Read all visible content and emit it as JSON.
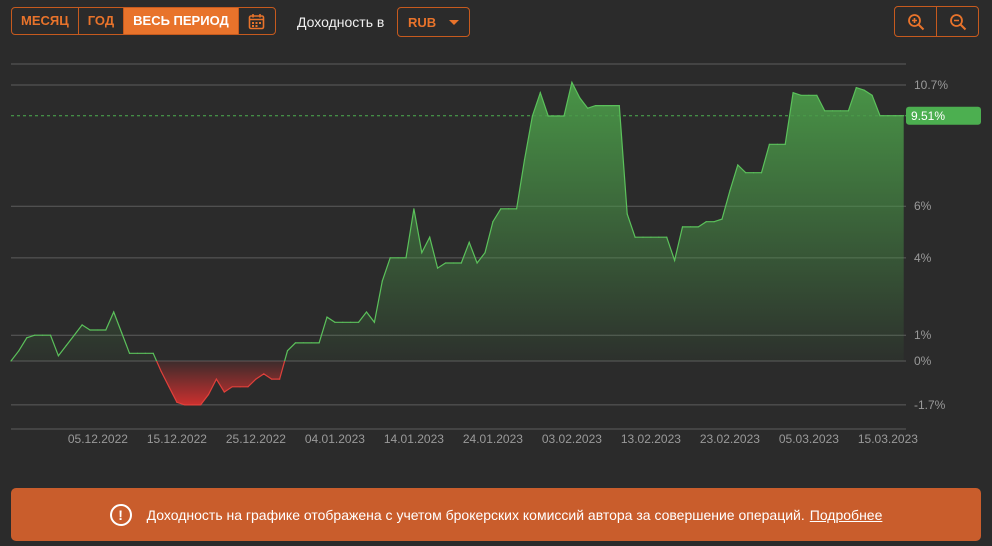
{
  "toolbar": {
    "periods": [
      "МЕСЯЦ",
      "ГОД",
      "ВЕСЬ ПЕРИОД"
    ],
    "active_period": "ВЕСЬ ПЕРИОД",
    "calendar_icon": "calendar-icon",
    "currency_label": "Доходность в",
    "currency_value": "RUB",
    "zoom_in_icon": "zoom-in-icon",
    "zoom_out_icon": "zoom-out-icon"
  },
  "colors": {
    "accent": "#e8732b",
    "positive": "#4caf50",
    "negative": "#d8302f",
    "banner": "#c95d2c"
  },
  "chart_data": {
    "type": "area",
    "y_unit": "%",
    "y_ticks": [
      {
        "value": 10.7,
        "label": "10.7%"
      },
      {
        "value": 6,
        "label": "6%"
      },
      {
        "value": 4,
        "label": "4%"
      },
      {
        "value": 1,
        "label": "1%"
      },
      {
        "value": 0,
        "label": "0%"
      },
      {
        "value": -1.7,
        "label": "-1.7%"
      }
    ],
    "x_ticks": [
      "05.12.2022",
      "15.12.2022",
      "25.12.2022",
      "04.01.2023",
      "14.01.2023",
      "24.01.2023",
      "03.02.2023",
      "13.02.2023",
      "23.02.2023",
      "05.03.2023",
      "15.03.2023"
    ],
    "current_value": 9.51,
    "current_label": "9.51%",
    "x_range": [
      "2022-11-24",
      "2023-03-20"
    ],
    "y_range": [
      -2.5,
      12
    ],
    "grid": true,
    "series": [
      {
        "x": [
          "2022-11-24",
          "2022-11-25",
          "2022-11-26",
          "2022-11-27",
          "2022-11-28",
          "2022-11-29",
          "2022-11-30",
          "2022-12-01",
          "2022-12-02",
          "2022-12-03",
          "2022-12-04",
          "2022-12-05",
          "2022-12-06",
          "2022-12-07",
          "2022-12-08",
          "2022-12-09",
          "2022-12-10",
          "2022-12-11",
          "2022-12-12",
          "2022-12-13",
          "2022-12-14",
          "2022-12-15",
          "2022-12-16",
          "2022-12-17",
          "2022-12-18",
          "2022-12-19",
          "2022-12-20",
          "2022-12-21",
          "2022-12-22",
          "2022-12-23",
          "2022-12-24",
          "2022-12-25",
          "2022-12-26",
          "2022-12-27",
          "2022-12-28",
          "2022-12-29",
          "2022-12-30",
          "2022-12-31",
          "2023-01-01",
          "2023-01-02",
          "2023-01-03",
          "2023-01-04",
          "2023-01-05",
          "2023-01-06",
          "2023-01-07",
          "2023-01-08",
          "2023-01-09",
          "2023-01-10",
          "2023-01-11",
          "2023-01-12",
          "2023-01-13",
          "2023-01-14",
          "2023-01-15",
          "2023-01-16",
          "2023-01-17",
          "2023-01-18",
          "2023-01-19",
          "2023-01-20",
          "2023-01-21",
          "2023-01-22",
          "2023-01-23",
          "2023-01-24",
          "2023-01-25",
          "2023-01-26",
          "2023-01-27",
          "2023-01-28",
          "2023-01-29",
          "2023-01-30",
          "2023-01-31",
          "2023-02-01",
          "2023-02-02",
          "2023-02-03",
          "2023-02-04",
          "2023-02-05",
          "2023-02-06",
          "2023-02-07",
          "2023-02-08",
          "2023-02-09",
          "2023-02-10",
          "2023-02-11",
          "2023-02-12",
          "2023-02-13",
          "2023-02-14",
          "2023-02-15",
          "2023-02-16",
          "2023-02-17",
          "2023-02-18",
          "2023-02-19",
          "2023-02-20",
          "2023-02-21",
          "2023-02-22",
          "2023-02-23",
          "2023-02-24",
          "2023-02-25",
          "2023-02-26",
          "2023-02-27",
          "2023-02-28",
          "2023-03-01",
          "2023-03-02",
          "2023-03-03",
          "2023-03-04",
          "2023-03-05",
          "2023-03-06",
          "2023-03-07",
          "2023-03-08",
          "2023-03-09",
          "2023-03-10",
          "2023-03-11",
          "2023-03-12",
          "2023-03-13",
          "2023-03-14",
          "2023-03-15",
          "2023-03-16",
          "2023-03-17"
        ],
        "values": [
          0.0,
          0.4,
          0.9,
          1.0,
          1.0,
          1.0,
          0.2,
          0.6,
          1.0,
          1.4,
          1.2,
          1.2,
          1.2,
          1.9,
          1.1,
          0.3,
          0.3,
          0.3,
          0.3,
          -0.4,
          -1.0,
          -1.6,
          -1.7,
          -1.7,
          -1.7,
          -1.3,
          -0.7,
          -1.2,
          -1.0,
          -1.0,
          -1.0,
          -0.7,
          -0.5,
          -0.7,
          -0.7,
          0.4,
          0.7,
          0.7,
          0.7,
          0.7,
          1.7,
          1.5,
          1.5,
          1.5,
          1.5,
          1.9,
          1.5,
          3.1,
          4.0,
          4.0,
          4.0,
          5.9,
          4.2,
          4.8,
          3.6,
          3.8,
          3.8,
          3.8,
          4.6,
          3.8,
          4.2,
          5.4,
          5.9,
          5.9,
          5.9,
          7.8,
          9.5,
          10.4,
          9.5,
          9.5,
          9.5,
          10.8,
          10.2,
          9.8,
          9.9,
          9.9,
          9.9,
          9.9,
          5.7,
          4.8,
          4.8,
          4.8,
          4.8,
          4.8,
          3.9,
          5.2,
          5.2,
          5.2,
          5.4,
          5.4,
          5.5,
          6.6,
          7.6,
          7.3,
          7.3,
          7.3,
          8.4,
          8.4,
          8.4,
          10.4,
          10.3,
          10.3,
          10.3,
          9.7,
          9.7,
          9.7,
          9.7,
          10.6,
          10.5,
          10.3,
          9.51,
          9.51,
          9.51,
          9.51
        ]
      }
    ]
  },
  "banner": {
    "icon": "warning-circle-icon",
    "text": "Доходность на графике отображена с учетом брокерских комиссий автора за совершение операций.",
    "link": "Подробнее"
  }
}
